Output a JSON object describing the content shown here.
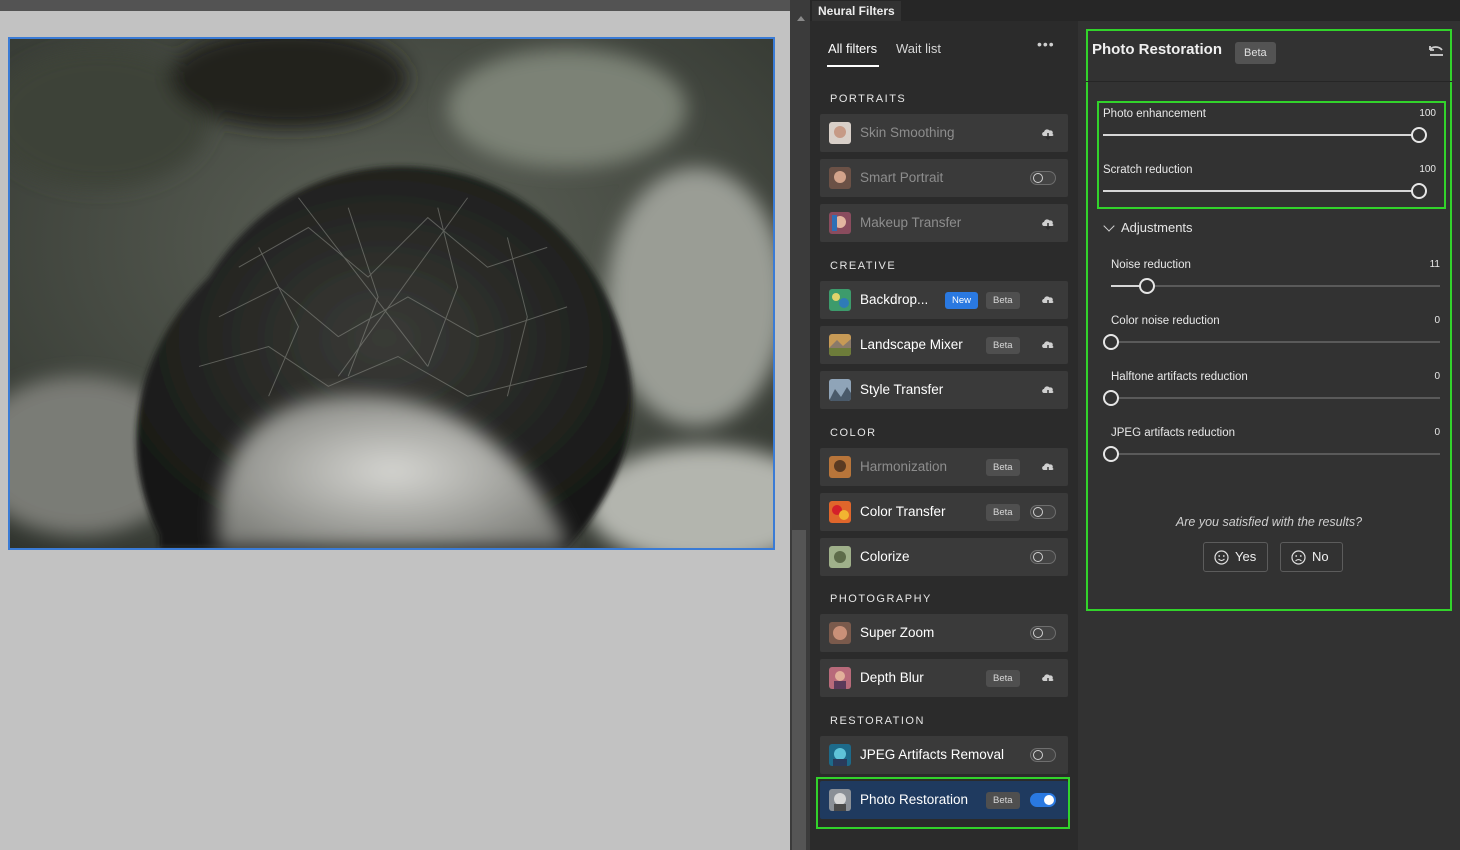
{
  "panel": {
    "tab_title": "Neural Filters"
  },
  "list": {
    "tabs": [
      {
        "label": "All filters",
        "active": true
      },
      {
        "label": "Wait list",
        "active": false
      }
    ],
    "more_icon": "more-icon",
    "sections": [
      {
        "label": "PORTRAITS"
      },
      {
        "label": "CREATIVE"
      },
      {
        "label": "COLOR"
      },
      {
        "label": "PHOTOGRAPHY"
      },
      {
        "label": "RESTORATION"
      }
    ],
    "filters": [
      {
        "name": "Skin Smoothing",
        "section": "PORTRAITS",
        "state": "download",
        "dim": true
      },
      {
        "name": "Smart Portrait",
        "section": "PORTRAITS",
        "state": "off",
        "dim": true
      },
      {
        "name": "Makeup Transfer",
        "section": "PORTRAITS",
        "state": "download",
        "dim": true
      },
      {
        "name": "Backdrop...",
        "section": "CREATIVE",
        "badges": [
          "New",
          "Beta"
        ],
        "state": "download",
        "dim": false
      },
      {
        "name": "Landscape Mixer",
        "section": "CREATIVE",
        "badges": [
          "Beta"
        ],
        "state": "download",
        "dim": false
      },
      {
        "name": "Style Transfer",
        "section": "CREATIVE",
        "state": "download",
        "dim": false
      },
      {
        "name": "Harmonization",
        "section": "COLOR",
        "badges": [
          "Beta"
        ],
        "state": "download",
        "dim": true
      },
      {
        "name": "Color Transfer",
        "section": "COLOR",
        "badges": [
          "Beta"
        ],
        "state": "off",
        "dim": false
      },
      {
        "name": "Colorize",
        "section": "COLOR",
        "state": "off",
        "dim": false
      },
      {
        "name": "Super Zoom",
        "section": "PHOTOGRAPHY",
        "state": "off",
        "dim": false
      },
      {
        "name": "Depth Blur",
        "section": "PHOTOGRAPHY",
        "badges": [
          "Beta"
        ],
        "state": "download",
        "dim": false
      },
      {
        "name": "JPEG Artifacts Removal",
        "section": "RESTORATION",
        "state": "off",
        "dim": false
      },
      {
        "name": "Photo Restoration",
        "section": "RESTORATION",
        "badges": [
          "Beta"
        ],
        "state": "on",
        "dim": false,
        "selected": true
      }
    ]
  },
  "settings": {
    "title": "Photo Restoration",
    "badge": "Beta",
    "reset_icon": "reset-icon",
    "sliders": [
      {
        "label": "Photo enhancement",
        "value": "100",
        "fraction": 1.0
      },
      {
        "label": "Scratch reduction",
        "value": "100",
        "fraction": 1.0
      }
    ],
    "adjustments": {
      "label": "Adjustments",
      "expanded": true,
      "sliders": [
        {
          "label": "Noise reduction",
          "value": "11",
          "fraction": 0.11
        },
        {
          "label": "Color noise reduction",
          "value": "0",
          "fraction": 0
        },
        {
          "label": "Halftone artifacts reduction",
          "value": "0",
          "fraction": 0
        },
        {
          "label": "JPEG artifacts reduction",
          "value": "0",
          "fraction": 0
        }
      ]
    },
    "feedback": {
      "question": "Are you satisfied with the results?",
      "yes": "Yes",
      "no": "No"
    }
  },
  "colors": {
    "accent": "#2a79e1",
    "highlight": "#32d32b",
    "panel_bg": "#323232"
  }
}
